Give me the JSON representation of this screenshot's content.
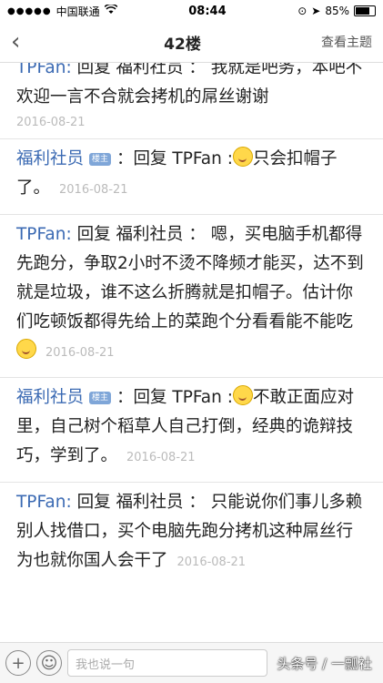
{
  "status": {
    "signal": "●●●●●",
    "carrier": "中国联通",
    "wifi": "wifi-icon",
    "time": "08:44",
    "battery": "85%",
    "battery_level": 0.85
  },
  "nav": {
    "back": "‹",
    "title": "42楼",
    "right": "查看主题"
  },
  "posts": [
    {
      "author": "TPFan:",
      "body": " 回复 福利社员 ： 我就是吧务，本吧不欢迎一言不合就会拷机的屌丝谢谢",
      "date": "2016-08-21"
    },
    {
      "author": "福利社员",
      "badge": "楼主",
      "body": "：回复 TPFan :",
      "body2": "只会扣帽子了。",
      "date": "2016-08-21"
    },
    {
      "author": "TPFan:",
      "body": " 回复 福利社员 ： 嗯，买电脑手机都得先跑分，争取2小时不烫不降频才能买，达不到就是垃圾，谁不这么折腾就是扣帽子。估计你们吃顿饭都得先给上的菜跑个分看看能不能吃",
      "date": "2016-08-21"
    },
    {
      "author": "福利社员",
      "badge": "楼主",
      "body": "：回复 TPFan :",
      "body2": "不敢正面应对里，自己树个稻草人自己打倒，经典的诡辩技巧，学到了。",
      "date": "2016-08-21"
    },
    {
      "author": "TPFan:",
      "body": " 回复 福利社员 ： 只能说你们事儿多赖别人找借口，买个电脑先跑分拷机这种屌丝行为也就你国人会干了",
      "date": "2016-08-21"
    }
  ],
  "bottom": {
    "add": "+",
    "emoji": "☺",
    "placeholder": "我也说一句",
    "watermark": "头条号 / 一瓢社"
  }
}
